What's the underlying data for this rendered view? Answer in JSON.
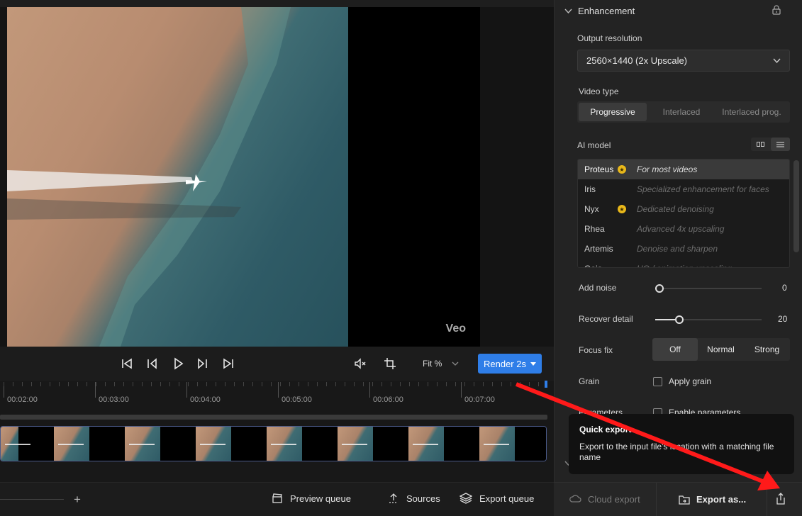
{
  "preview": {
    "watermark": "Veo"
  },
  "transport": {
    "fit_label": "Fit %",
    "render_label": "Render 2s"
  },
  "timeline": {
    "ruler_labels": [
      "00:02:00",
      "00:03:00",
      "00:04:00",
      "00:05:00",
      "00:06:00",
      "00:07:00"
    ]
  },
  "bottombar": {
    "preview_queue": "Preview queue",
    "sources": "Sources",
    "export_queue": "Export queue"
  },
  "panel": {
    "section_title": "Enhancement",
    "output_resolution_label": "Output resolution",
    "output_resolution_value": "2560×1440 (2x Upscale)",
    "video_type_label": "Video type",
    "video_types": [
      "Progressive",
      "Interlaced",
      "Interlaced prog."
    ],
    "video_type_selected": "Progressive",
    "ai_model_label": "AI model",
    "models": [
      {
        "name": "Proteus",
        "desc": "For most videos",
        "starred": true,
        "selected": true
      },
      {
        "name": "Iris",
        "desc": "Specialized enhancement for faces",
        "starred": false,
        "selected": false
      },
      {
        "name": "Nyx",
        "desc": "Dedicated denoising",
        "starred": true,
        "selected": false
      },
      {
        "name": "Rhea",
        "desc": "Advanced 4x upscaling",
        "starred": false,
        "selected": false
      },
      {
        "name": "Artemis",
        "desc": "Denoise and sharpen",
        "starred": false,
        "selected": false
      },
      {
        "name": "Gaia",
        "desc": "HQ / animation upscaling",
        "starred": false,
        "selected": false
      }
    ],
    "add_noise_label": "Add noise",
    "add_noise_value": "0",
    "add_noise_level": 0,
    "recover_detail_label": "Recover detail",
    "recover_detail_value": "20",
    "recover_detail_level": 0.2,
    "focus_fix_label": "Focus fix",
    "focus_fix_options": [
      "Off",
      "Normal",
      "Strong"
    ],
    "focus_fix_selected": "Off",
    "grain_label": "Grain",
    "grain_checkbox": "Apply grain",
    "parameters_label": "Parameters",
    "parameters_checkbox": "Enable parameters"
  },
  "exportbar": {
    "cloud_export": "Cloud export",
    "export_as": "Export as..."
  },
  "tooltip": {
    "title": "Quick export",
    "body": "Export to the input file's location with a matching file name"
  },
  "colors": {
    "accent": "#2f7ee8",
    "annotation_arrow": "#ff1a1a",
    "star": "#e9b81a"
  }
}
